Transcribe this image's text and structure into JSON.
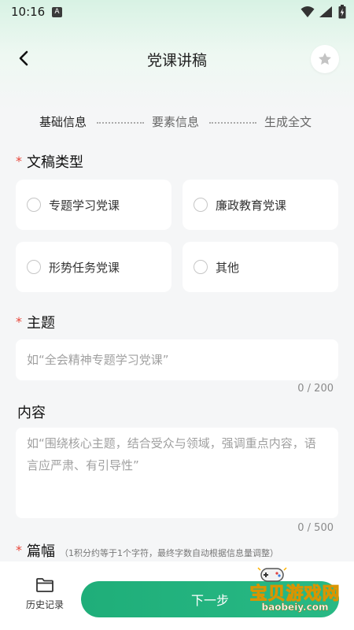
{
  "status_bar": {
    "time": "10:16",
    "notification_glyph": "A"
  },
  "header": {
    "title": "党课讲稿",
    "back_icon": "chevron-left-icon",
    "favorite_icon": "star-icon"
  },
  "stepper": {
    "steps": [
      {
        "label": "基础信息",
        "active": true
      },
      {
        "label": "要素信息",
        "active": false
      },
      {
        "label": "生成全文",
        "active": false
      }
    ]
  },
  "form": {
    "required_mark": "*",
    "doc_type": {
      "label": "文稿类型",
      "options": [
        "专题学习党课",
        "廉政教育党课",
        "形势任务党课",
        "其他"
      ]
    },
    "topic": {
      "label": "主题",
      "placeholder": "如“全会精神专题学习党课”",
      "counter": "0 / 200"
    },
    "content": {
      "label": "内容",
      "placeholder": "如“围绕核心主题，结合受众与领域，强调重点内容，语言应严肃、有引导性”",
      "counter": "0 / 500"
    },
    "length": {
      "label": "篇幅",
      "hint": "（1积分约等于1个字符，最终字数自动根据信息量调整）"
    }
  },
  "bottom_bar": {
    "history_label": "历史记录",
    "next_label": "下一步"
  },
  "watermark": {
    "title": "宝贝游戏网",
    "url": "baobeiy.com"
  },
  "colors": {
    "accent": "#22b27e",
    "required": "#e8473b",
    "background": "#f5f6f7"
  }
}
